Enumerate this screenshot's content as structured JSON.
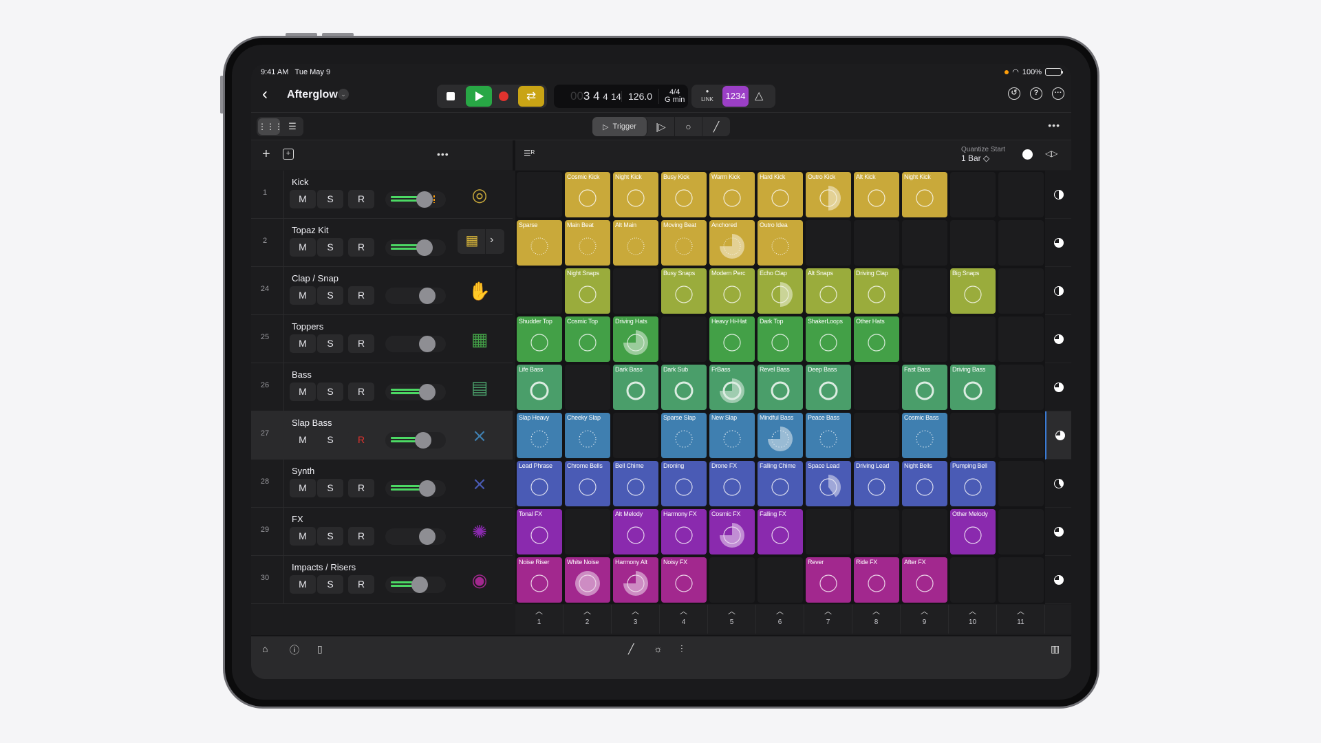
{
  "status_bar": {
    "time": "9:41 AM",
    "date": "Tue May 9",
    "battery": "100%"
  },
  "title_bar": {
    "back_label": "‹",
    "project_name": "Afterglow",
    "lcd": {
      "bar": "3",
      "beat": "4",
      "div": "4",
      "tick": "14",
      "tempo": "126.0",
      "time_sig": "4/4",
      "key": "G min"
    },
    "link_label": "LINK",
    "count_in_label": "1234",
    "right_icons": [
      "undo-icon",
      "help-icon",
      "more-icon"
    ]
  },
  "toolbar": {
    "view_grid_glyph": "⋮⋮⋮",
    "view_list_glyph": "☰",
    "modes": [
      {
        "name": "trigger",
        "label": "Trigger",
        "active": true
      },
      {
        "name": "retrigger"
      },
      {
        "name": "record-loop"
      },
      {
        "name": "pencil"
      }
    ],
    "more": "•••"
  },
  "header": {
    "add": "+",
    "more": "•••",
    "quantize_label": "Quantize Start",
    "quantize_value": "1 Bar ◇"
  },
  "tracks": [
    {
      "number": "1",
      "name": "Kick",
      "color": "#c9a93a",
      "instrument": "drum-kick-icon",
      "rec_armed": false,
      "volume": 0.55,
      "meter_bars": 2
    },
    {
      "number": "2",
      "name": "Topaz Kit",
      "color": "#c9a93a",
      "instrument": "drum-kit-icon",
      "rec_armed": false,
      "volume": 0.55,
      "meter_bars": 2
    },
    {
      "number": "24",
      "name": "Clap / Snap",
      "color": "#9aac3c",
      "instrument": "hand-clap-icon",
      "rec_armed": false,
      "volume": 0.6,
      "meter_bars": 0
    },
    {
      "number": "25",
      "name": "Toppers",
      "color": "#43a047",
      "instrument": "drum-machine-icon",
      "rec_armed": false,
      "volume": 0.6,
      "meter_bars": 0
    },
    {
      "number": "26",
      "name": "Bass",
      "color": "#4a9e6a",
      "instrument": "synth-keys-icon",
      "rec_armed": false,
      "volume": 0.6,
      "meter_bars": 2
    },
    {
      "number": "27",
      "name": "Slap Bass",
      "color": "#3f7fb0",
      "instrument": "keyboard-stand-icon",
      "rec_armed": true,
      "volume": 0.52,
      "meter_bars": 2,
      "selected": true
    },
    {
      "number": "28",
      "name": "Synth",
      "color": "#4a5bb5",
      "instrument": "keyboard-stand-icon",
      "rec_armed": false,
      "volume": 0.6,
      "meter_bars": 2
    },
    {
      "number": "29",
      "name": "FX",
      "color": "#8a2aae",
      "instrument": "fx-burst-icon",
      "rec_armed": false,
      "volume": 0.6,
      "meter_bars": 0
    },
    {
      "number": "30",
      "name": "Impacts / Risers",
      "color": "#a2288e",
      "instrument": "turntable-icon",
      "rec_armed": false,
      "volume": 0.45,
      "meter_bars": 2
    }
  ],
  "track_labels": {
    "mute": "M",
    "solo": "S",
    "record": "R"
  },
  "clips": [
    [
      null,
      "Cosmic Kick",
      "Night Kick",
      "Busy Kick",
      "Warm Kick",
      "Hard Kick",
      "Outro Kick",
      "Alt Kick",
      "Night Kick",
      null,
      null
    ],
    [
      "Sparse",
      "Main Beat",
      "Alt Main",
      "Moving Beat",
      "Anchored",
      "Outro Idea",
      null,
      null,
      null,
      null,
      null
    ],
    [
      null,
      "Night Snaps",
      null,
      "Busy Snaps",
      "Modern Perc",
      "Echo Clap",
      "Alt Snaps",
      "Driving Clap",
      null,
      "Big Snaps",
      null
    ],
    [
      "Shudder Top",
      "Cosmic Top",
      "Driving Hats",
      null,
      "Heavy Hi-Hat",
      "Dark Top",
      "ShakerLoops",
      "Other Hats",
      null,
      null,
      null
    ],
    [
      "Life Bass",
      null,
      "Dark Bass",
      "Dark Sub",
      "FrBass",
      "Revel Bass",
      "Deep Bass",
      null,
      "Fast Bass",
      "Driving Bass",
      null
    ],
    [
      "Slap Heavy",
      "Cheeky Slap",
      null,
      "Sparse Slap",
      "New Slap",
      "Mindful Bass",
      "Peace Bass",
      null,
      "Cosmic Bass",
      null,
      null
    ],
    [
      "Lead Phrase",
      "Chrome Bells",
      "Bell Chime",
      "Droning",
      "Drone FX",
      "Falling Chime",
      "Space Lead",
      "Driving Lead",
      "Night Bells",
      "Pumping Bell",
      null
    ],
    [
      "Tonal FX",
      null,
      "Alt Melody",
      "Harmony FX",
      "Cosmic FX",
      "Falling FX",
      null,
      null,
      null,
      "Other Melody",
      null
    ],
    [
      "Noise Riser",
      "White Noise",
      "Harmony Alt",
      "Noisy FX",
      null,
      null,
      "Rever",
      "Ride FX",
      "After FX",
      null,
      null
    ]
  ],
  "playing_clips": [
    {
      "row": 0,
      "col": 6,
      "progress": 0.5
    },
    {
      "row": 1,
      "col": 4,
      "progress": 0.75
    },
    {
      "row": 2,
      "col": 5,
      "progress": 0.5
    },
    {
      "row": 3,
      "col": 2,
      "progress": 0.75
    },
    {
      "row": 4,
      "col": 4,
      "progress": 0.75
    },
    {
      "row": 5,
      "col": 5,
      "progress": 0.75
    },
    {
      "row": 6,
      "col": 6,
      "progress": 0.4
    },
    {
      "row": 7,
      "col": 4,
      "progress": 0.75
    },
    {
      "row": 8,
      "col": 1,
      "progress": 1.0
    },
    {
      "row": 8,
      "col": 2,
      "progress": 0.75
    }
  ],
  "track_progress": [
    0.5,
    0.75,
    0.5,
    0.75,
    0.75,
    0.75,
    0.4,
    0.75,
    0.75
  ],
  "columns": [
    "1",
    "2",
    "3",
    "4",
    "5",
    "6",
    "7",
    "8",
    "9",
    "10",
    "11"
  ],
  "bottom_bar": {
    "left_icons": [
      "inbox-icon",
      "info-icon",
      "sidebar-icon"
    ],
    "center_icons": [
      "pencil-icon",
      "smart-controls-icon",
      "mixer-icon"
    ],
    "right_icons": [
      "piano-keyboard-icon"
    ]
  }
}
